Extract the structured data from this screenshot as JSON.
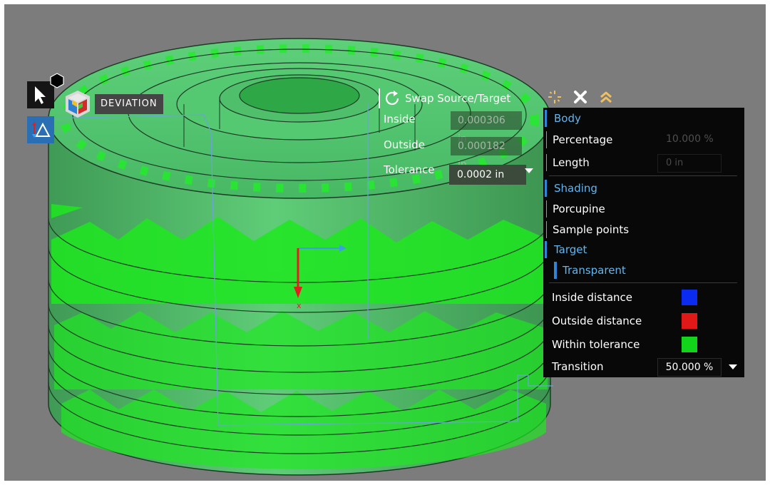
{
  "toolbar": {
    "tool_title": "Deviation",
    "icons": [
      "select-arrow-icon",
      "deviation-delta-icon",
      "deviation-cube-icon",
      "hexagon-marker-icon"
    ]
  },
  "mini_toolbar": {
    "swap_label": "Swap Source/Target",
    "inside_label": "Inside",
    "inside_value": "0.000306 in",
    "outside_label": "Outside",
    "outside_value": "0.000182 in",
    "tolerance_label": "Tolerance",
    "tolerance_value": "0.0002 in"
  },
  "panel": {
    "header_icons": [
      "options-icon",
      "close-icon",
      "collapse-icon"
    ],
    "body_section": "Body",
    "percentage_label": "Percentage",
    "percentage_value": "10.000 %",
    "length_label": "Length",
    "length_value": "0 in",
    "shading_section": "Shading",
    "porcupine_label": "Porcupine",
    "sample_points_label": "Sample points",
    "target_section": "Target",
    "transparent_label": "Transparent",
    "inside_distance_label": "Inside distance",
    "outside_distance_label": "Outside distance",
    "within_tolerance_label": "Within tolerance",
    "transition_label": "Transition",
    "transition_value": "50.000 %"
  },
  "colors": {
    "inside_distance": "#0b2cf0",
    "outside_distance": "#e01818",
    "within_tolerance": "#12d41a",
    "accent_blue": "#2f86d6",
    "icon_gold": "#f0c060",
    "viewport_bg": "#7c7c7c"
  }
}
